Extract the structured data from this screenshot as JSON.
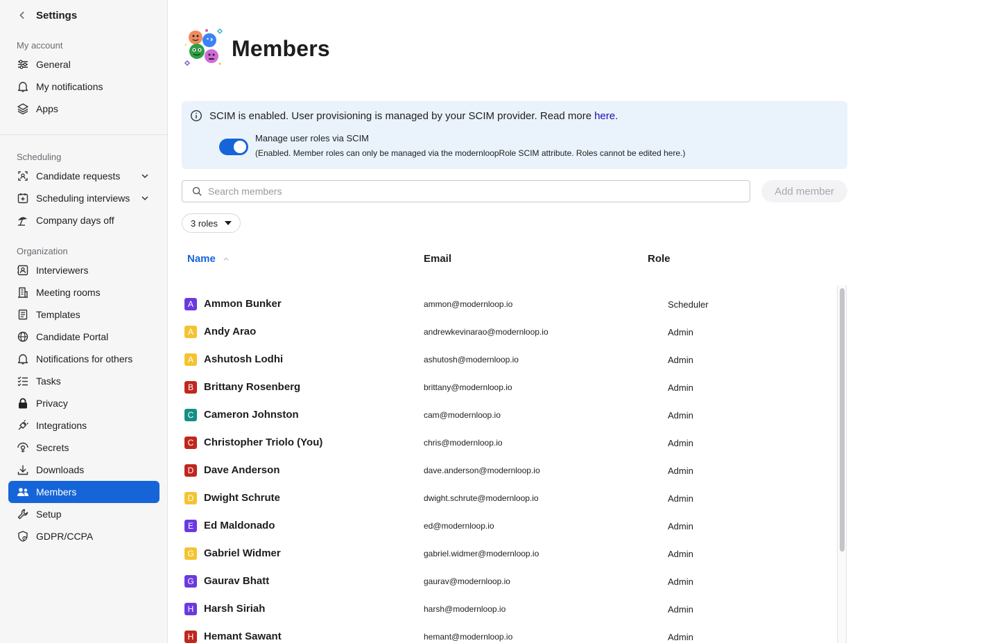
{
  "sidebar": {
    "title": "Settings",
    "sections": [
      {
        "title": "My account",
        "items": [
          {
            "label": "General",
            "icon": "sliders-icon"
          },
          {
            "label": "My notifications",
            "icon": "bell-icon"
          },
          {
            "label": "Apps",
            "icon": "layers-icon"
          }
        ]
      },
      {
        "title": "Scheduling",
        "items": [
          {
            "label": "Candidate requests",
            "icon": "candidate-requests-icon",
            "expandable": true
          },
          {
            "label": "Scheduling interviews",
            "icon": "calendar-plus-icon",
            "expandable": true
          },
          {
            "label": "Company days off",
            "icon": "beach-umbrella-icon"
          }
        ]
      },
      {
        "title": "Organization",
        "items": [
          {
            "label": "Interviewers",
            "icon": "id-badge-icon"
          },
          {
            "label": "Meeting rooms",
            "icon": "building-icon"
          },
          {
            "label": "Templates",
            "icon": "document-icon"
          },
          {
            "label": "Candidate Portal",
            "icon": "globe-icon"
          },
          {
            "label": "Notifications for others",
            "icon": "bell-icon"
          },
          {
            "label": "Tasks",
            "icon": "checklist-icon"
          },
          {
            "label": "Privacy",
            "icon": "lock-icon"
          },
          {
            "label": "Integrations",
            "icon": "plug-icon"
          },
          {
            "label": "Secrets",
            "icon": "secret-icon"
          },
          {
            "label": "Downloads",
            "icon": "download-icon"
          },
          {
            "label": "Members",
            "icon": "people-icon",
            "active": true
          },
          {
            "label": "Setup",
            "icon": "wrench-icon"
          },
          {
            "label": "GDPR/CCPA",
            "icon": "shield-icon"
          }
        ]
      }
    ]
  },
  "page": {
    "title": "Members"
  },
  "banner": {
    "text": "SCIM is enabled. User provisioning is managed by your SCIM provider. Read more",
    "link": "here",
    "link_suffix": ".",
    "toggle_label": "Manage user roles via SCIM",
    "toggle_on": true,
    "toggle_sub": "(Enabled. Member roles can only be managed via the modernloopRole SCIM attribute. Roles cannot be edited here.)"
  },
  "search": {
    "placeholder": "Search members",
    "value": ""
  },
  "add_member_label": "Add member",
  "roles_filter_label": "3 roles",
  "table": {
    "columns": {
      "name": "Name",
      "email": "Email",
      "role": "Role"
    },
    "rows": [
      {
        "initial": "A",
        "color": "#6b39e0",
        "name": "Ammon Bunker",
        "email": "ammon@modernloop.io",
        "role": "Scheduler"
      },
      {
        "initial": "A",
        "color": "#f4c430",
        "name": "Andy Arao",
        "email": "andrewkevinarao@modernloop.io",
        "role": "Admin"
      },
      {
        "initial": "A",
        "color": "#f4c430",
        "name": "Ashutosh Lodhi",
        "email": "ashutosh@modernloop.io",
        "role": "Admin"
      },
      {
        "initial": "B",
        "color": "#c0271d",
        "name": "Brittany Rosenberg",
        "email": "brittany@modernloop.io",
        "role": "Admin"
      },
      {
        "initial": "C",
        "color": "#138f86",
        "name": "Cameron Johnston",
        "email": "cam@modernloop.io",
        "role": "Admin"
      },
      {
        "initial": "C",
        "color": "#c0271d",
        "name": "Christopher Triolo (You)",
        "email": "chris@modernloop.io",
        "role": "Admin"
      },
      {
        "initial": "D",
        "color": "#c0271d",
        "name": "Dave Anderson",
        "email": "dave.anderson@modernloop.io",
        "role": "Admin"
      },
      {
        "initial": "D",
        "color": "#f4c430",
        "name": "Dwight Schrute",
        "email": "dwight.schrute@modernloop.io",
        "role": "Admin"
      },
      {
        "initial": "E",
        "color": "#6b39e0",
        "name": "Ed Maldonado",
        "email": "ed@modernloop.io",
        "role": "Admin"
      },
      {
        "initial": "G",
        "color": "#f4c430",
        "name": "Gabriel Widmer",
        "email": "gabriel.widmer@modernloop.io",
        "role": "Admin"
      },
      {
        "initial": "G",
        "color": "#6b39e0",
        "name": "Gaurav Bhatt",
        "email": "gaurav@modernloop.io",
        "role": "Admin"
      },
      {
        "initial": "H",
        "color": "#6b39e0",
        "name": "Harsh Siriah",
        "email": "harsh@modernloop.io",
        "role": "Admin"
      },
      {
        "initial": "H",
        "color": "#c0271d",
        "name": "Hemant Sawant",
        "email": "hemant@modernloop.io",
        "role": "Admin"
      }
    ]
  },
  "colors": {
    "accent": "#1665d8",
    "banner_bg": "#eaf3fc",
    "link": "#1a0dab"
  }
}
